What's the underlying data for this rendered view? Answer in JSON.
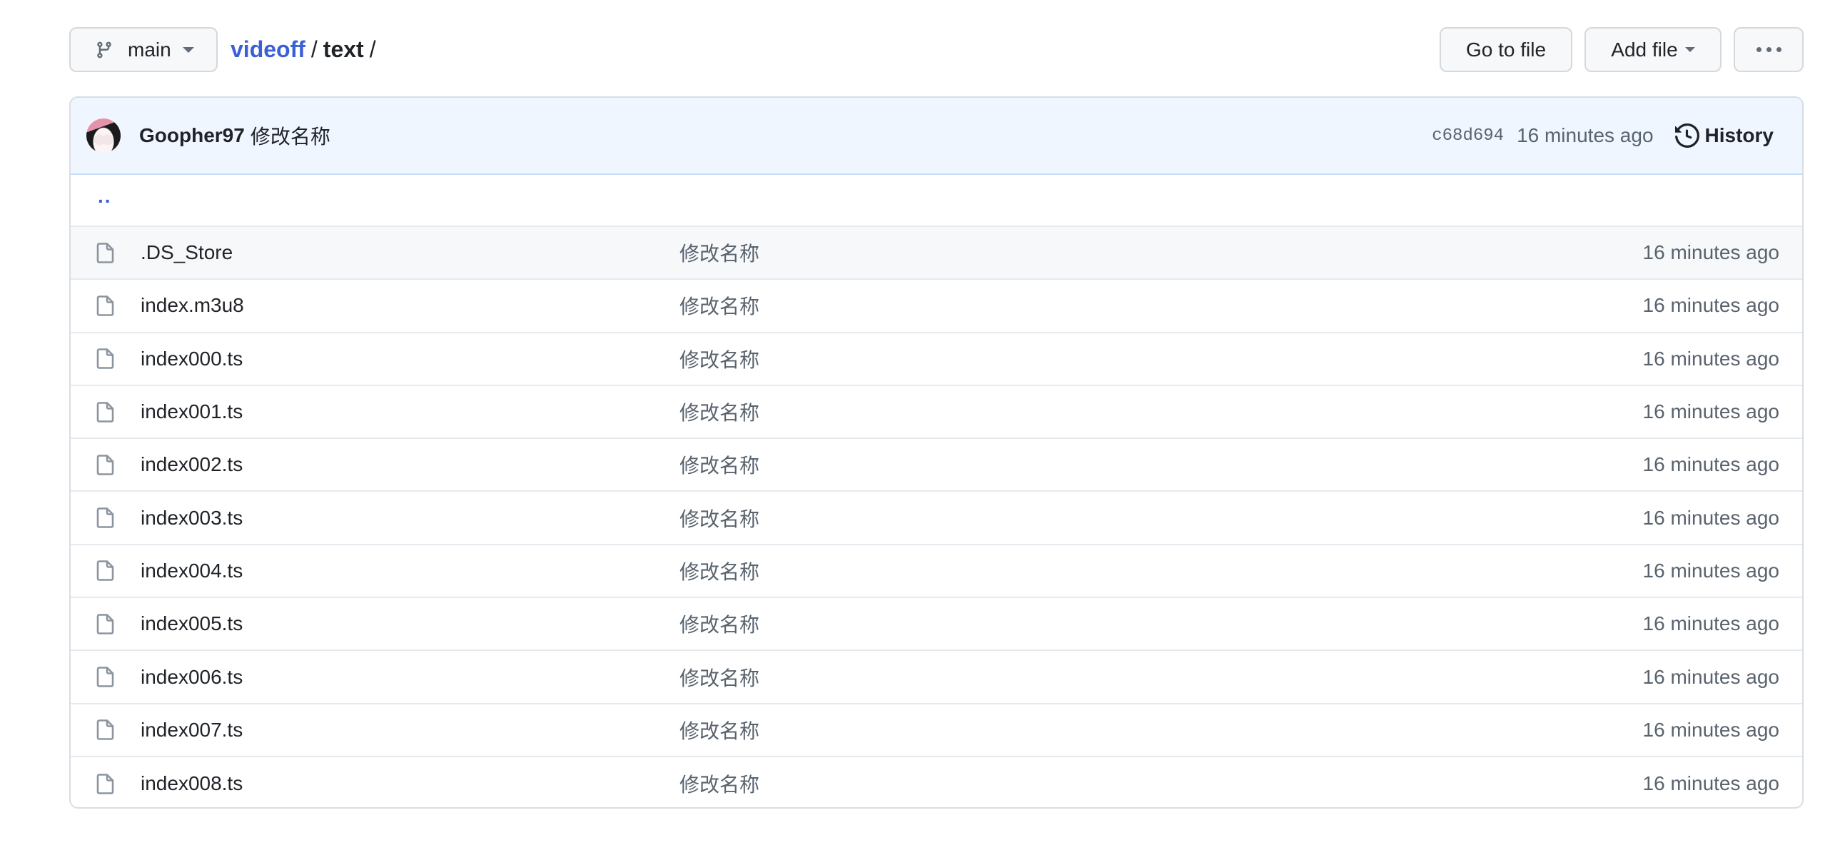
{
  "toolbar": {
    "branch": "main",
    "breadcrumb": {
      "repo": "videoff",
      "separator": "/",
      "dir": "text",
      "trailing": "/"
    },
    "go_to_file": "Go to file",
    "add_file": "Add file",
    "more_icon": "kebab-horizontal-icon"
  },
  "commit": {
    "author": "Goopher97",
    "message": "修改名称",
    "sha": "c68d694",
    "time": "16 minutes ago",
    "history_label": "History"
  },
  "parent_dir": "..",
  "files": [
    {
      "name": ".DS_Store",
      "message": "修改名称",
      "time": "16 minutes ago"
    },
    {
      "name": "index.m3u8",
      "message": "修改名称",
      "time": "16 minutes ago"
    },
    {
      "name": "index000.ts",
      "message": "修改名称",
      "time": "16 minutes ago"
    },
    {
      "name": "index001.ts",
      "message": "修改名称",
      "time": "16 minutes ago"
    },
    {
      "name": "index002.ts",
      "message": "修改名称",
      "time": "16 minutes ago"
    },
    {
      "name": "index003.ts",
      "message": "修改名称",
      "time": "16 minutes ago"
    },
    {
      "name": "index004.ts",
      "message": "修改名称",
      "time": "16 minutes ago"
    },
    {
      "name": "index005.ts",
      "message": "修改名称",
      "time": "16 minutes ago"
    },
    {
      "name": "index006.ts",
      "message": "修改名称",
      "time": "16 minutes ago"
    },
    {
      "name": "index007.ts",
      "message": "修改名称",
      "time": "16 minutes ago"
    },
    {
      "name": "index008.ts",
      "message": "修改名称",
      "time": "16 minutes ago"
    }
  ],
  "colors": {
    "link": "#3b5fd4",
    "header_bg": "#f0f6ff",
    "hover_row_bg": "#f6f8fa",
    "muted_text": "#59636e"
  }
}
